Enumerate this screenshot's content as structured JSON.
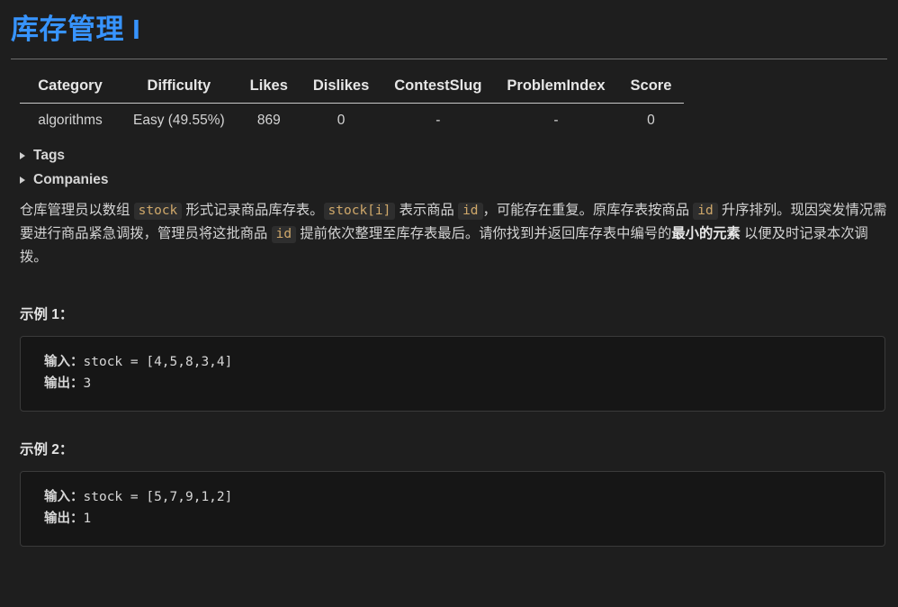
{
  "page": {
    "title": "库存管理 I",
    "background_color": "#1e1e1e",
    "title_color": "#3794ff",
    "code_color": "#cfa86a"
  },
  "meta_table": {
    "headers": [
      "Category",
      "Difficulty",
      "Likes",
      "Dislikes",
      "ContestSlug",
      "ProblemIndex",
      "Score"
    ],
    "row": {
      "category": "algorithms",
      "difficulty": "Easy (49.55%)",
      "likes": "869",
      "dislikes": "0",
      "contest_slug": "-",
      "problem_index": "-",
      "score": "0"
    }
  },
  "collapsibles": [
    {
      "label": "Tags",
      "expanded": false
    },
    {
      "label": "Companies",
      "expanded": false
    }
  ],
  "description": {
    "line1_part1": "仓库管理员以数组 ",
    "code1": "stock",
    "line1_part2": " 形式记录商品库存表。",
    "code2": "stock[i]",
    "line1_part3": " 表示商品 ",
    "code3": "id",
    "line1_part4": "，可能存在重复。原库存表按商品 ",
    "code4": "id",
    "line1_part5": " 升序排列。现因突发情况需要进行商品紧急调拨，管理员将这批商品 ",
    "code5": "id",
    "line1_part6": " 提前依次整理至库存表最后。请你找到并返回库存表中编号的",
    "bold_phrase": "最小的元素",
    "line1_part7": " 以便及时记录本次调拨。"
  },
  "examples": [
    {
      "title": "示例 1：",
      "input_label": "输入：",
      "input_value": "stock = [4,5,8,3,4]",
      "output_label": "输出：",
      "output_value": "3"
    },
    {
      "title": "示例 2：",
      "input_label": "输入：",
      "input_value": "stock = [5,7,9,1,2]",
      "output_label": "输出：",
      "output_value": "1"
    }
  ]
}
